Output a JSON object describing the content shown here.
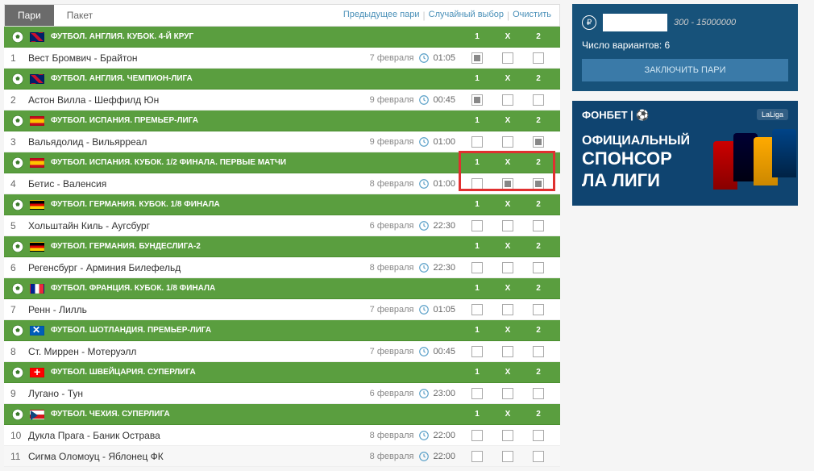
{
  "tabs": {
    "pari": "Пари",
    "paket": "Пакет"
  },
  "links": {
    "prev": "Предыдущее пари",
    "random": "Случайный выбор",
    "clear": "Очистить"
  },
  "header_cols": {
    "c1": "1",
    "cx": "X",
    "c2": "2"
  },
  "groups": [
    {
      "flag": "gb",
      "title": "ФУТБОЛ. АНГЛИЯ. КУБОК. 4-Й КРУГ",
      "matches": [
        {
          "num": "1",
          "name": "Вест Бромвич - Брайтон",
          "date": "7 февраля",
          "time": "01:05",
          "checks": [
            true,
            false,
            false
          ]
        }
      ]
    },
    {
      "flag": "gb",
      "title": "ФУТБОЛ. АНГЛИЯ. ЧЕМПИОН-ЛИГА",
      "matches": [
        {
          "num": "2",
          "name": "Астон Вилла - Шеффилд Юн",
          "date": "9 февраля",
          "time": "00:45",
          "checks": [
            true,
            false,
            false
          ]
        }
      ]
    },
    {
      "flag": "es",
      "title": "ФУТБОЛ. ИСПАНИЯ. ПРЕМЬЕР-ЛИГА",
      "matches": [
        {
          "num": "3",
          "name": "Вальядолид - Вильярреал",
          "date": "9 февраля",
          "time": "01:00",
          "checks": [
            false,
            false,
            true
          ]
        }
      ]
    },
    {
      "flag": "es",
      "title": "ФУТБОЛ. ИСПАНИЯ. КУБОК. 1/2 ФИНАЛА. ПЕРВЫЕ МАТЧИ",
      "highlight": true,
      "matches": [
        {
          "num": "4",
          "name": "Бетис - Валенсия",
          "date": "8 февраля",
          "time": "01:00",
          "checks": [
            false,
            true,
            true
          ]
        }
      ]
    },
    {
      "flag": "de",
      "title": "ФУТБОЛ. ГЕРМАНИЯ. КУБОК. 1/8 ФИНАЛА",
      "matches": [
        {
          "num": "5",
          "name": "Хольштайн Киль - Аугсбург",
          "date": "6 февраля",
          "time": "22:30",
          "checks": [
            false,
            false,
            false
          ]
        }
      ]
    },
    {
      "flag": "de",
      "title": "ФУТБОЛ. ГЕРМАНИЯ. БУНДЕСЛИГА-2",
      "matches": [
        {
          "num": "6",
          "name": "Регенсбург - Арминия Билефельд",
          "date": "8 февраля",
          "time": "22:30",
          "checks": [
            false,
            false,
            false
          ]
        }
      ]
    },
    {
      "flag": "fr",
      "title": "ФУТБОЛ. ФРАНЦИЯ. КУБОК. 1/8 ФИНАЛА",
      "matches": [
        {
          "num": "7",
          "name": "Ренн - Лилль",
          "date": "7 февраля",
          "time": "01:05",
          "checks": [
            false,
            false,
            false
          ]
        }
      ]
    },
    {
      "flag": "sco",
      "title": "ФУТБОЛ. ШОТЛАНДИЯ. ПРЕМЬЕР-ЛИГА",
      "matches": [
        {
          "num": "8",
          "name": "Ст. Миррен - Мотеруэлл",
          "date": "7 февраля",
          "time": "00:45",
          "checks": [
            false,
            false,
            false
          ]
        }
      ]
    },
    {
      "flag": "ch",
      "title": "ФУТБОЛ. ШВЕЙЦАРИЯ. СУПЕРЛИГА",
      "matches": [
        {
          "num": "9",
          "name": "Лугано - Тун",
          "date": "6 февраля",
          "time": "23:00",
          "checks": [
            false,
            false,
            false
          ]
        }
      ]
    },
    {
      "flag": "cz",
      "title": "ФУТБОЛ. ЧЕХИЯ. СУПЕРЛИГА",
      "matches": [
        {
          "num": "10",
          "name": "Дукла Прага - Баник Острава",
          "date": "8 февраля",
          "time": "22:00",
          "checks": [
            false,
            false,
            false
          ]
        },
        {
          "num": "11",
          "name": "Сигма Оломоуц - Яблонец ФК",
          "date": "8 февраля",
          "time": "22:00",
          "checks": [
            false,
            false,
            false
          ]
        }
      ]
    }
  ],
  "bet": {
    "range": "300 - 15000000",
    "variants_label": "Число вариантов:",
    "variants_count": "6",
    "button": "ЗАКЛЮЧИТЬ ПАРИ"
  },
  "promo": {
    "logo": "ФОНБЕТ",
    "laliga": "LaLiga",
    "line1": "ОФИЦИАЛЬНЫЙ",
    "line2": "СПОНСОР",
    "line3": "ЛА ЛИГИ"
  }
}
